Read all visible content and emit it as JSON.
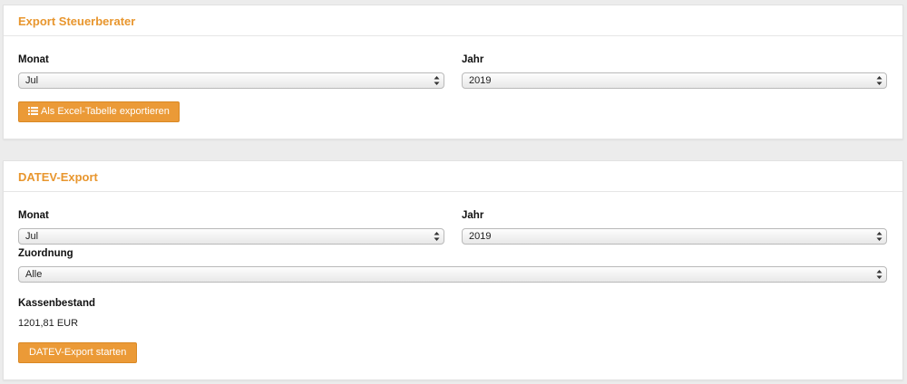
{
  "steuerberater": {
    "title": "Export Steuerberater",
    "monat_label": "Monat",
    "monat_value": "Jul",
    "jahr_label": "Jahr",
    "jahr_value": "2019",
    "export_button": "Als Excel-Tabelle exportieren",
    "export_icon": "list-icon"
  },
  "datev": {
    "title": "DATEV-Export",
    "monat_label": "Monat",
    "monat_value": "Jul",
    "jahr_label": "Jahr",
    "jahr_value": "2019",
    "zuordnung_label": "Zuordnung",
    "zuordnung_value": "Alle",
    "kassenbestand_label": "Kassenbestand",
    "kassenbestand_value": "1201,81 EUR",
    "start_button": "DATEV-Export starten"
  },
  "colors": {
    "accent": "#eb9a37",
    "title": "#e8962e"
  }
}
